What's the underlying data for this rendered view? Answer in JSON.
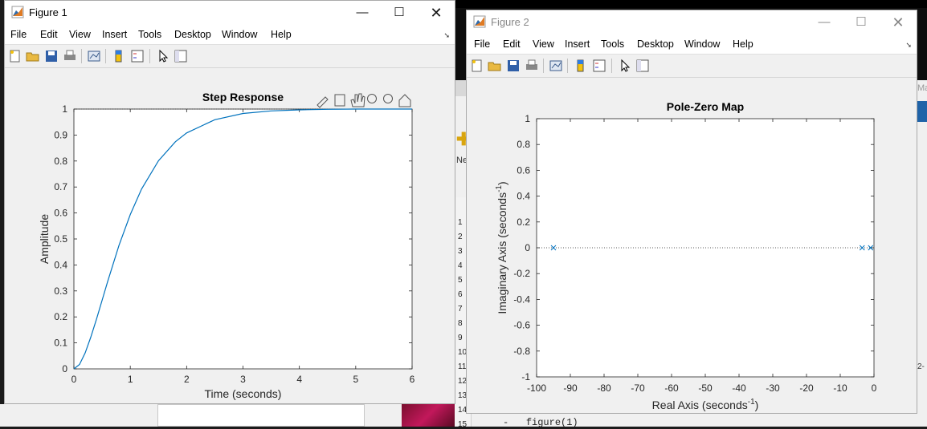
{
  "background": {
    "line_numbers": [
      "1",
      "2",
      "3",
      "4",
      "5",
      "6",
      "7",
      "8",
      "9",
      "10",
      "11",
      "12",
      "13",
      "14",
      "15"
    ],
    "code_line_15": "figure(1)",
    "code_line_15_marker": "-",
    "toolstrip_label": "Ne",
    "truncated_tab": "Ma",
    "truncated_text": "2-"
  },
  "figure1": {
    "title": "Figure 1",
    "menu": [
      "File",
      "Edit",
      "View",
      "Insert",
      "Tools",
      "Desktop",
      "Window",
      "Help"
    ],
    "colors": {
      "line": "#0072bd",
      "axes_bg": "#ffffff",
      "figure_bg": "#f0f0f0"
    },
    "chart_data": {
      "type": "line",
      "title": "Step Response",
      "xlabel": "Time (seconds)",
      "ylabel": "Amplitude",
      "xlim": [
        0,
        6
      ],
      "ylim": [
        0,
        1
      ],
      "xticks": [
        "0",
        "1",
        "2",
        "3",
        "4",
        "5",
        "6"
      ],
      "yticks": [
        "0",
        "0.1",
        "0.2",
        "0.3",
        "0.4",
        "0.5",
        "0.6",
        "0.7",
        "0.8",
        "0.9",
        "1"
      ],
      "series": [
        {
          "x": [
            0,
            0.1,
            0.2,
            0.3,
            0.4,
            0.5,
            0.6,
            0.8,
            1.0,
            1.2,
            1.5,
            1.8,
            2.0,
            2.5,
            3.0,
            3.5,
            4.0,
            4.5,
            5.0,
            5.5,
            6.0
          ],
          "y": [
            0,
            0.017,
            0.061,
            0.122,
            0.191,
            0.264,
            0.337,
            0.475,
            0.594,
            0.692,
            0.801,
            0.874,
            0.908,
            0.959,
            0.983,
            0.993,
            0.997,
            0.999,
            1.0,
            1.0,
            1.0
          ]
        }
      ],
      "final_value_line": 1,
      "grid": false,
      "axes_toolbar_icons": [
        "brush-icon",
        "data-tips-icon",
        "pan-icon",
        "zoom-in-icon",
        "zoom-out-icon",
        "home-icon"
      ]
    }
  },
  "figure2": {
    "title": "Figure 2",
    "menu": [
      "File",
      "Edit",
      "View",
      "Insert",
      "Tools",
      "Desktop",
      "Window",
      "Help"
    ],
    "colors": {
      "marker": "#0072bd",
      "axes_bg": "#ffffff"
    },
    "chart_data": {
      "type": "scatter",
      "title": "Pole-Zero Map",
      "xlabel": "Real Axis (seconds",
      "xlabel_sup": "-1",
      "xlabel_close": ")",
      "ylabel": "Imaginary Axis (seconds",
      "ylabel_sup": "-1",
      "ylabel_close": ")",
      "xlim": [
        -100,
        0
      ],
      "ylim": [
        -1,
        1
      ],
      "xticks": [
        "-100",
        "-90",
        "-80",
        "-70",
        "-60",
        "-50",
        "-40",
        "-30",
        "-20",
        "-10",
        "0"
      ],
      "yticks": [
        "-1",
        "-0.8",
        "-0.6",
        "-0.4",
        "-0.2",
        "0",
        "0.2",
        "0.4",
        "0.6",
        "0.8",
        "1"
      ],
      "marker": "x",
      "poles": [
        {
          "re": -95,
          "im": 0
        },
        {
          "re": -3.5,
          "im": 0
        },
        {
          "re": -1,
          "im": 0
        }
      ],
      "zero_line": "dotted"
    }
  }
}
